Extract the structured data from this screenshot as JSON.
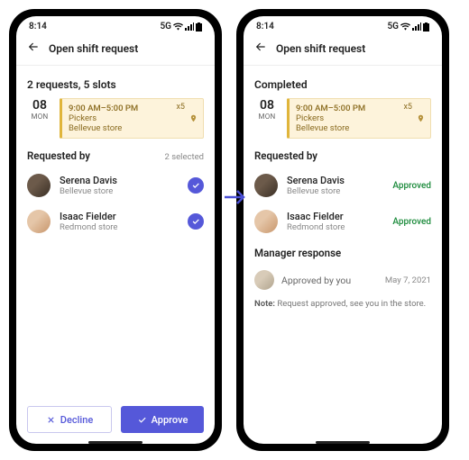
{
  "status": {
    "time": "8:14",
    "net": "5G"
  },
  "header": {
    "title": "Open shift request"
  },
  "left": {
    "subtitle": "2 requests, 5 slots",
    "footer": {
      "decline": "Decline",
      "approve": "Approve"
    }
  },
  "right": {
    "subtitle": "Completed",
    "manager": {
      "label": "Manager response",
      "text": "Approved by you",
      "date": "May 7, 2021",
      "note_prefix": "Note:",
      "note_body": " Request approved, see you in the store."
    }
  },
  "shift": {
    "daynum": "08",
    "dayname": "MON",
    "time": "9:00 AM–5:00 PM",
    "role": "Pickers",
    "loc": "Bellevue store",
    "slots": "x5"
  },
  "requested": {
    "label": "Requested by",
    "selected": "2 selected",
    "approved": "Approved",
    "people": [
      {
        "name": "Serena Davis",
        "store": "Bellevue store"
      },
      {
        "name": "Isaac Fielder",
        "store": "Redmond store"
      }
    ]
  }
}
